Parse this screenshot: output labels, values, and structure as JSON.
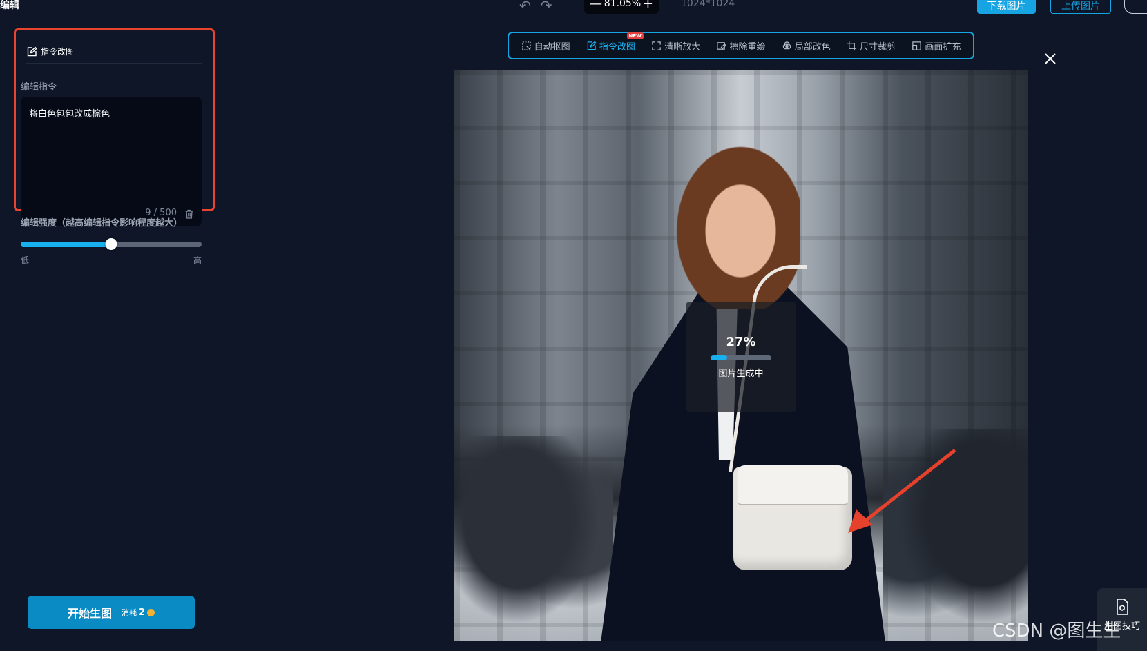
{
  "topbar": {
    "title": "编辑",
    "zoom": "81.05%",
    "zoom_out_symbol": "—",
    "zoom_in_symbol": "+",
    "resolution": "1024*1024",
    "download_label": "下载图片",
    "upload_label": "上传图片",
    "undo_icon": "undo-icon",
    "redo_icon": "redo-icon"
  },
  "left_panel": {
    "card_title": "指令改图",
    "instruction_label": "编辑指令",
    "instruction_value": "将白色包包改成棕色",
    "char_count": "9 / 500",
    "strength_label": "编辑强度（越高编辑指令影响程度越大）",
    "strength_value": 0.5,
    "slider_low": "低",
    "slider_high": "高",
    "generate_label": "开始生图",
    "cost_label": "消耗",
    "cost_value": "2"
  },
  "toolbar": {
    "tools": [
      {
        "label": "自动抠图",
        "icon": "auto-matting-icon"
      },
      {
        "label": "指令改图",
        "icon": "edit-icon",
        "badge": "NEW"
      },
      {
        "label": "清晰放大",
        "icon": "upscale-icon"
      },
      {
        "label": "擦除重绘",
        "icon": "erase-icon"
      },
      {
        "label": "局部改色",
        "icon": "recolor-icon"
      },
      {
        "label": "尺寸裁剪",
        "icon": "crop-icon"
      },
      {
        "label": "画面扩充",
        "icon": "expand-icon"
      }
    ],
    "active_index": 1
  },
  "progress": {
    "percent_text": "27%",
    "value": 0.27,
    "label": "图片生成中"
  },
  "side_tool": {
    "label": "生图技巧"
  },
  "watermark": "CSDN @图生生",
  "colors": {
    "accent": "#17a4e2",
    "highlight_border": "#e8442f",
    "background": "#0e1628"
  }
}
